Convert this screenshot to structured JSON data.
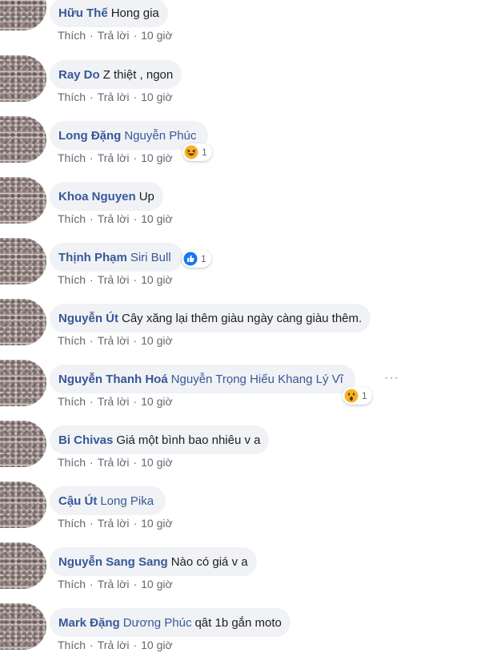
{
  "comments": [
    {
      "author": "Hữu Thế",
      "tag": "",
      "text": "Hong gia",
      "like": "Thích",
      "reply": "Trả lời",
      "time": "10 giờ"
    },
    {
      "author": "Ray Do",
      "tag": "",
      "text": "Z thiệt , ngon",
      "like": "Thích",
      "reply": "Trả lời",
      "time": "10 giờ"
    },
    {
      "author": "Long Đặng",
      "tag": "Nguyễn Phúc",
      "text": "",
      "like": "Thích",
      "reply": "Trả lời",
      "time": "10 giờ",
      "reaction": {
        "type": "haha",
        "count": "1"
      }
    },
    {
      "author": "Khoa Nguyen",
      "tag": "",
      "text": "Up",
      "like": "Thích",
      "reply": "Trả lời",
      "time": "10 giờ"
    },
    {
      "author": "Thịnh Phạm",
      "tag": "Siri Bull",
      "text": "",
      "like": "Thích",
      "reply": "Trả lời",
      "time": "10 giờ",
      "reaction": {
        "type": "like",
        "count": "1"
      }
    },
    {
      "author": "Nguyễn Út",
      "tag": "",
      "text": "Cây xăng lại thêm giàu ngày càng giàu thêm.",
      "like": "Thích",
      "reply": "Trả lời",
      "time": "10 giờ"
    },
    {
      "author": "Nguyễn Thanh Hoá",
      "tag": "Nguyễn Trọng Hiếu Khang Lý Vĩ",
      "text": "",
      "like": "Thích",
      "reply": "Trả lời",
      "time": "10 giờ",
      "reaction": {
        "type": "wow",
        "count": "1"
      },
      "more_label": "···"
    },
    {
      "author": "Bi Chivas",
      "tag": "",
      "text": "Giá một bình bao nhiêu v a",
      "like": "Thích",
      "reply": "Trả lời",
      "time": "10 giờ"
    },
    {
      "author": "Cậu Út",
      "tag": "Long Pika",
      "text": "",
      "like": "Thích",
      "reply": "Trả lời",
      "time": "10 giờ"
    },
    {
      "author": "Nguyễn Sang Sang",
      "tag": "",
      "text": "Nào có giá v a",
      "like": "Thích",
      "reply": "Trả lời",
      "time": "10 giờ"
    },
    {
      "author": "Mark Đặng",
      "tag": "Dương Phúc",
      "text": "qât 1b gắn moto",
      "like": "Thích",
      "reply": "Trả lời",
      "time": "10 giờ"
    }
  ],
  "colors": {
    "name_link": "#385898",
    "bubble_bg": "#f0f2f5",
    "meta_text": "#65676b",
    "like_blue": "#1877f2",
    "emoji_yellow": "#f7b125"
  }
}
